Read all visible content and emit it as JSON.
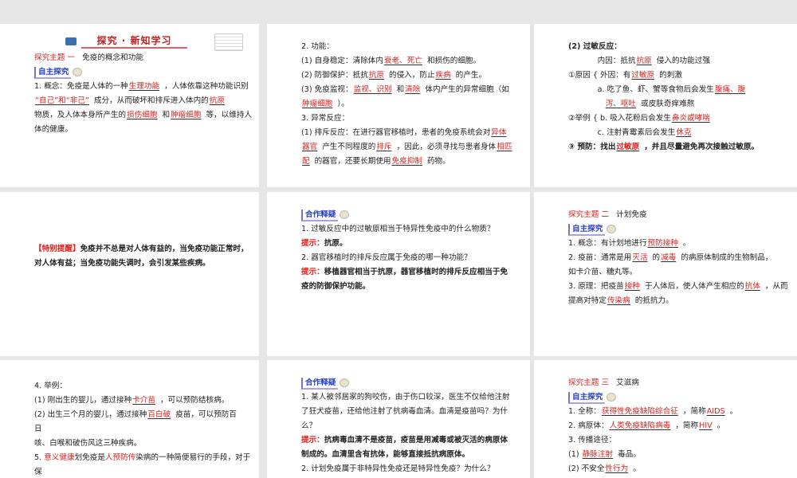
{
  "slides": [
    {
      "id": "s1",
      "lines": [
        {
          "kind": "banner",
          "segs": [
            "探究 · 新知学习"
          ]
        },
        {
          "kind": "heading",
          "segs": [
            {
              "r": "探究主题 一"
            },
            "   免疫的概念和功能"
          ]
        },
        {
          "kind": "badge",
          "segs": [
            "自主探究"
          ]
        },
        {
          "kind": "text",
          "segs": [
            "1. 概念：免疫是人体的一种",
            {
              "a": "生理功能"
            },
            "，人体依靠这种功能识别"
          ]
        },
        {
          "kind": "text",
          "segs": [
            {
              "a": "“自己”和“非己”"
            },
            "成分，从而破坏和排斥进入体内的",
            {
              "a": "抗原"
            }
          ]
        },
        {
          "kind": "text",
          "segs": [
            "物质，及人体本身所产生的",
            {
              "a": "损伤细胞"
            },
            "和",
            {
              "a": "肿瘤细胞"
            },
            "等，以维持人"
          ]
        },
        {
          "kind": "text",
          "segs": [
            "体的健康。"
          ]
        }
      ]
    },
    {
      "id": "s2",
      "lines": [
        {
          "kind": "text",
          "segs": [
            "2. 功能："
          ]
        },
        {
          "kind": "text",
          "segs": [
            "(1) 自身稳定：清除体内",
            {
              "a": "衰老、死亡"
            },
            "和损伤的细胞。"
          ]
        },
        {
          "kind": "text",
          "segs": [
            "(2) 防御保护：抵抗",
            {
              "a": "抗原"
            },
            "的侵入，防止",
            {
              "a": "疾病"
            },
            "的产生。"
          ]
        },
        {
          "kind": "text",
          "segs": [
            "(3) 免疫监视：",
            {
              "a": "监视、识别"
            },
            "和",
            {
              "a": "清除"
            },
            "体内产生的异常细胞（如"
          ]
        },
        {
          "kind": "text",
          "segs": [
            {
              "a": "肿瘤细胞"
            },
            "）。"
          ]
        },
        {
          "kind": "text",
          "segs": [
            "3. 异常反应："
          ]
        },
        {
          "kind": "text",
          "segs": [
            "(1) 排斥反应：在进行器官移植时，患者的免疫系统会对",
            {
              "a": "异体"
            }
          ]
        },
        {
          "kind": "text",
          "segs": [
            {
              "a": "器官"
            },
            "产生不同程度的",
            {
              "a": "排斥"
            },
            "，因此，必须寻找与患者身体",
            {
              "a": "相匹"
            }
          ]
        },
        {
          "kind": "text",
          "segs": [
            {
              "a": "配"
            },
            "的器官，还要长期使用",
            {
              "a": "免疫抑制"
            },
            "药物。"
          ]
        }
      ]
    },
    {
      "id": "s3",
      "lines": [
        {
          "kind": "bold",
          "segs": [
            "(2) 过敏反应："
          ]
        },
        {
          "kind": "text",
          "segs": [
            "            内因：抵抗",
            {
              "a": "抗原"
            },
            "侵入的功能过强"
          ]
        },
        {
          "kind": "text",
          "segs": [
            "①原因 { 外因：有",
            {
              "a": "过敏原"
            },
            "的刺激"
          ]
        },
        {
          "kind": "text",
          "segs": [
            "            a. 吃了鱼、虾、蟹等食物后会发生",
            {
              "a": "腹痛、腹"
            }
          ]
        },
        {
          "kind": "text",
          "segs": [
            "               ",
            {
              "a": "泻、呕吐"
            },
            "或皮肤奇痒难熬"
          ]
        },
        {
          "kind": "text",
          "segs": [
            "②举例 { b. 吸入花粉后会发生",
            {
              "a": "鼻炎或哮喘"
            }
          ]
        },
        {
          "kind": "text",
          "segs": [
            "            c. 注射青霉素后会发生",
            {
              "a": "休克"
            }
          ]
        },
        {
          "kind": "bold",
          "segs": [
            "③ 预防：找出",
            {
              "a": "过敏原"
            },
            "，并且尽量避免再次接触过敏原。"
          ]
        }
      ]
    },
    {
      "id": "s4",
      "lines": [
        {
          "kind": "tipline",
          "segs": [
            {
              "r": "【特别提醒】"
            },
            "免疫并不总是对人体有益的，当免疫功能正常时，"
          ]
        },
        {
          "kind": "bold",
          "segs": [
            "对人体有益；当免疫功能失调时，会引发某些疾病。"
          ]
        }
      ]
    },
    {
      "id": "s5",
      "lines": [
        {
          "kind": "badge",
          "segs": [
            "合作释疑"
          ]
        },
        {
          "kind": "text",
          "segs": [
            "1. 过敏反应中的过敏原相当于特异性免疫中的什么物质？"
          ]
        },
        {
          "kind": "tip",
          "segs": [
            {
              "r": "提示："
            },
            "抗原。"
          ]
        },
        {
          "kind": "text",
          "segs": [
            "2. 器官移植时的排斥反应属于免疫的哪一种功能？"
          ]
        },
        {
          "kind": "tip",
          "segs": [
            {
              "r": "提示："
            },
            "移植器官相当于抗原，器官移植时的排斥反应相当于免"
          ]
        },
        {
          "kind": "tip",
          "segs": [
            "疫的防御保护功能。"
          ]
        }
      ]
    },
    {
      "id": "s6",
      "lines": [
        {
          "kind": "heading",
          "segs": [
            {
              "r": "探究主题 二"
            },
            "   计划免疫"
          ]
        },
        {
          "kind": "badge",
          "segs": [
            "自主探究"
          ]
        },
        {
          "kind": "text",
          "segs": [
            "1. 概念：有计划地进行",
            {
              "a": "预防接种"
            },
            "。"
          ]
        },
        {
          "kind": "text",
          "segs": [
            "2. 疫苗：通常是用",
            {
              "a": "灭活"
            },
            "的",
            {
              "a": "减毒"
            },
            "的病原体制成的生物制品，"
          ]
        },
        {
          "kind": "text",
          "segs": [
            "如卡介苗、糖丸等。"
          ]
        },
        {
          "kind": "text",
          "segs": [
            "3. 原理：把疫苗",
            {
              "a": "接种"
            },
            "于人体后，使人体产生相应的",
            {
              "a": "抗体"
            },
            "，从而"
          ]
        },
        {
          "kind": "text",
          "segs": [
            "提高对特定",
            {
              "a": "传染病"
            },
            "的抵抗力。"
          ]
        }
      ]
    },
    {
      "id": "s7",
      "lines": [
        {
          "kind": "text",
          "segs": [
            "4. 举例："
          ]
        },
        {
          "kind": "text",
          "segs": [
            "(1) 刚出生的婴儿，通过接种",
            {
              "a": "卡介苗"
            },
            "，可以预防结核病。"
          ]
        },
        {
          "kind": "text",
          "segs": [
            "(2) 出生三个月的婴儿，通过接种",
            {
              "a": "百白破"
            },
            "疫苗，可以预防百"
          ]
        },
        {
          "kind": "text",
          "segs": [
            "日"
          ]
        },
        {
          "kind": "text",
          "segs": [
            "咳、白喉和破伤风这三种疾病。"
          ]
        },
        {
          "kind": "text",
          "segs": [
            "5. ",
            {
              "r": "意义健康"
            },
            "划免疫是",
            {
              "r": "人预防传"
            },
            "染病的一种简便易行的手段，对于"
          ]
        },
        {
          "kind": "text",
          "segs": [
            "保"
          ]
        }
      ]
    },
    {
      "id": "s8",
      "lines": [
        {
          "kind": "badge",
          "segs": [
            "合作释疑"
          ]
        },
        {
          "kind": "text",
          "segs": [
            "1. 某人被邻居家的狗咬伤，由于伤口较深，医生不仅给他注射"
          ]
        },
        {
          "kind": "text",
          "segs": [
            "了狂犬疫苗，还给他注射了抗病毒血清。血清是疫苗吗？为什"
          ]
        },
        {
          "kind": "text",
          "segs": [
            "么？"
          ]
        },
        {
          "kind": "tip",
          "segs": [
            {
              "r": "提示："
            },
            "抗病毒血清不是疫苗，疫苗是用减毒或被灭活的病原体"
          ]
        },
        {
          "kind": "tip",
          "segs": [
            "制成的。血清里含有抗体，能够直接抵抗病原体。"
          ]
        },
        {
          "kind": "text",
          "segs": [
            "2. 计划免疫属于非特异性免疫还是特异性免疫？为什么？"
          ]
        }
      ]
    },
    {
      "id": "s9",
      "lines": [
        {
          "kind": "heading",
          "segs": [
            {
              "r": "探究主题 三"
            },
            "   艾滋病"
          ]
        },
        {
          "kind": "badge",
          "segs": [
            "自主探究"
          ]
        },
        {
          "kind": "text",
          "segs": [
            "1. 全称：",
            {
              "a": "获得性免疫缺陷综合征"
            },
            "，简称",
            {
              "a": "AIDS"
            },
            "。"
          ]
        },
        {
          "kind": "text",
          "segs": [
            "2. 病原体：",
            {
              "a": "人类免疫缺陷病毒"
            },
            "，简称",
            {
              "a": "HIV"
            },
            "。"
          ]
        },
        {
          "kind": "text",
          "segs": [
            "3. 传播途径："
          ]
        },
        {
          "kind": "text",
          "segs": [
            "(1) ",
            {
              "a": "静脉注射"
            },
            "毒品。"
          ]
        },
        {
          "kind": "text",
          "segs": [
            "(2) 不安全",
            {
              "a": "性行为"
            },
            "。"
          ]
        }
      ]
    }
  ]
}
